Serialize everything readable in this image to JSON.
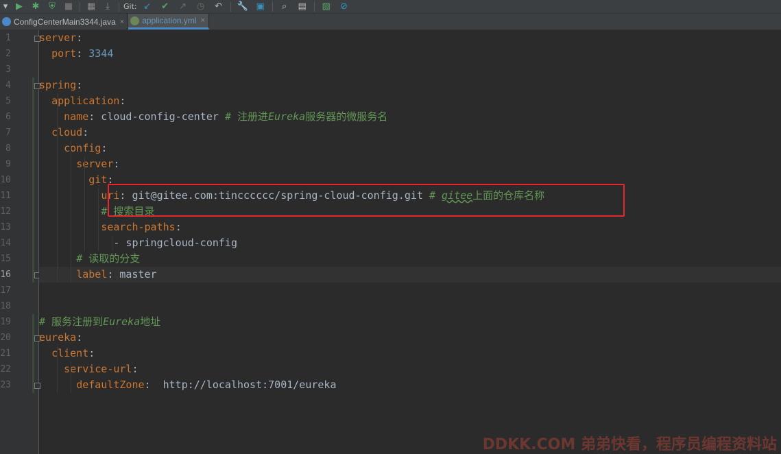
{
  "toolbar": {
    "items": [
      {
        "name": "dropdown-arrow-icon",
        "glyph": "▾"
      },
      {
        "name": "run-icon",
        "glyph": "▶",
        "color": "#59a869"
      },
      {
        "name": "debug-icon",
        "glyph": "✱",
        "color": "#59a869"
      },
      {
        "name": "coverage-icon",
        "glyph": "⛨",
        "color": "#59a869"
      },
      {
        "name": "stop-icon",
        "glyph": "■",
        "color": "#6b6b6b"
      },
      {
        "name": "build-icon",
        "glyph": "▦",
        "color": "#8a8a8a"
      },
      {
        "name": "profile-icon",
        "glyph": "⤓",
        "color": "#8a8a8a"
      }
    ],
    "git_label": "Git:",
    "git_items": [
      {
        "name": "git-update-icon",
        "glyph": "↙",
        "color": "#3592c4"
      },
      {
        "name": "git-commit-icon",
        "glyph": "✔",
        "color": "#59a869"
      },
      {
        "name": "git-push-icon",
        "glyph": "↗",
        "color": "#6b6b6b"
      },
      {
        "name": "git-history-icon",
        "glyph": "◷",
        "color": "#6b6b6b"
      },
      {
        "name": "git-rollback-icon",
        "glyph": "↶",
        "color": "#bbbbbb"
      }
    ],
    "tool_items": [
      {
        "name": "settings-wrench-icon",
        "glyph": "🔧",
        "color": "#bbbbbb"
      },
      {
        "name": "project-structure-icon",
        "glyph": "▣",
        "color": "#3592c4"
      },
      {
        "name": "search-icon",
        "glyph": "⌕",
        "color": "#bbbbbb"
      },
      {
        "name": "presentation-icon",
        "glyph": "▤",
        "color": "#bbbbbb"
      },
      {
        "name": "activity-monitor-icon",
        "glyph": "▧",
        "color": "#59a869"
      },
      {
        "name": "power-save-icon",
        "glyph": "⊘",
        "color": "#3592c4"
      }
    ]
  },
  "tabs": [
    {
      "label": "ConfigCenterMain3344.java",
      "active": false,
      "icon_color": "#4a88c7"
    },
    {
      "label": "application.yml",
      "active": true,
      "icon_color": "#6a8759"
    }
  ],
  "close_glyph": "×",
  "lines": [
    {
      "n": "1",
      "tokens": [
        [
          "key",
          "server"
        ],
        [
          "val",
          ":"
        ]
      ]
    },
    {
      "n": "2",
      "tokens": [
        [
          "val",
          "  "
        ],
        [
          "key",
          "port"
        ],
        [
          "val",
          ": "
        ],
        [
          "num",
          "3344"
        ]
      ]
    },
    {
      "n": "3",
      "tokens": []
    },
    {
      "n": "4",
      "tokens": [
        [
          "key",
          "spring"
        ],
        [
          "val",
          ":"
        ]
      ]
    },
    {
      "n": "5",
      "tokens": [
        [
          "val",
          "  "
        ],
        [
          "key",
          "application"
        ],
        [
          "val",
          ":"
        ]
      ]
    },
    {
      "n": "6",
      "tokens": [
        [
          "val",
          "    "
        ],
        [
          "key",
          "name"
        ],
        [
          "val",
          ": cloud-config-center "
        ],
        [
          "cmt",
          "# 注册进"
        ],
        [
          "cmt-it",
          "Eureka"
        ],
        [
          "cmt",
          "服务器的微服务名"
        ]
      ]
    },
    {
      "n": "7",
      "tokens": [
        [
          "val",
          "  "
        ],
        [
          "key",
          "cloud"
        ],
        [
          "val",
          ":"
        ]
      ]
    },
    {
      "n": "8",
      "tokens": [
        [
          "val",
          "    "
        ],
        [
          "key",
          "config"
        ],
        [
          "val",
          ":"
        ]
      ]
    },
    {
      "n": "9",
      "tokens": [
        [
          "val",
          "      "
        ],
        [
          "key",
          "server"
        ],
        [
          "val",
          ":"
        ]
      ]
    },
    {
      "n": "10",
      "tokens": [
        [
          "val",
          "        "
        ],
        [
          "key",
          "git"
        ],
        [
          "val",
          ":"
        ]
      ]
    },
    {
      "n": "11",
      "tokens": [
        [
          "val",
          "          "
        ],
        [
          "key",
          "uri"
        ],
        [
          "val",
          ": git@gitee.com:tincccccc/spring-cloud-config.git "
        ],
        [
          "cmt",
          "# "
        ],
        [
          "typo",
          "gitee"
        ],
        [
          "cmt",
          "上面的仓库名称"
        ]
      ]
    },
    {
      "n": "12",
      "tokens": [
        [
          "val",
          "          "
        ],
        [
          "cmt",
          "# 搜索目录"
        ]
      ]
    },
    {
      "n": "13",
      "tokens": [
        [
          "val",
          "          "
        ],
        [
          "key",
          "search-paths"
        ],
        [
          "val",
          ":"
        ]
      ]
    },
    {
      "n": "14",
      "tokens": [
        [
          "val",
          "            - springcloud-config"
        ]
      ]
    },
    {
      "n": "15",
      "tokens": [
        [
          "val",
          "      "
        ],
        [
          "cmt",
          "# 读取的分支"
        ]
      ]
    },
    {
      "n": "16",
      "current": true,
      "tokens": [
        [
          "val",
          "      "
        ],
        [
          "key",
          "label"
        ],
        [
          "val",
          ": master"
        ]
      ]
    },
    {
      "n": "17",
      "tokens": []
    },
    {
      "n": "18",
      "tokens": []
    },
    {
      "n": "19",
      "tokens": [
        [
          "cmt",
          "# 服务注册到"
        ],
        [
          "cmt-it",
          "Eureka"
        ],
        [
          "cmt",
          "地址"
        ]
      ]
    },
    {
      "n": "20",
      "tokens": [
        [
          "key",
          "eureka"
        ],
        [
          "val",
          ":"
        ]
      ]
    },
    {
      "n": "21",
      "tokens": [
        [
          "val",
          "  "
        ],
        [
          "key",
          "client"
        ],
        [
          "val",
          ":"
        ]
      ]
    },
    {
      "n": "22",
      "tokens": [
        [
          "val",
          "    "
        ],
        [
          "key",
          "service-url"
        ],
        [
          "val",
          ":"
        ]
      ]
    },
    {
      "n": "23",
      "tokens": [
        [
          "val",
          "      "
        ],
        [
          "key",
          "defaultZone"
        ],
        [
          "val",
          ":  http://localhost:7001/eureka"
        ]
      ]
    }
  ],
  "watermark": "DDKK.COM 弟弟快看，程序员编程资料站",
  "colors": {
    "background": "#2b2b2b",
    "keyword": "#cc7832",
    "comment": "#629755",
    "number": "#6897bb",
    "highlight_box": "#e8262b"
  }
}
